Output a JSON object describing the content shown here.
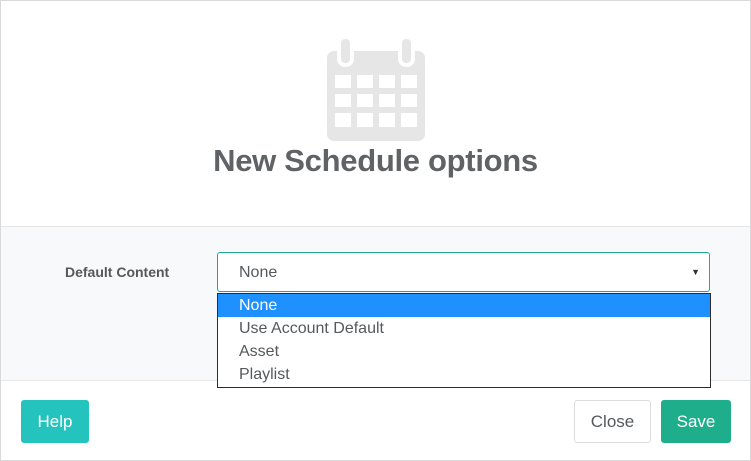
{
  "icons": {
    "header_icon": "calendar-icon",
    "dropdown_caret": "caret-down-icon",
    "icon_color": "#e6e6e6"
  },
  "modal": {
    "title": "New Schedule options"
  },
  "form": {
    "default_content": {
      "label": "Default Content",
      "value": "None",
      "caret": "▼",
      "options": [
        "None",
        "Use Account Default",
        "Asset",
        "Playlist"
      ],
      "selected_option": "None"
    }
  },
  "footer": {
    "help_label": "Help",
    "close_label": "Close",
    "save_label": "Save"
  },
  "colors": {
    "help": "#25c3bd",
    "save": "#1fae8b",
    "select_border": "#20a98f",
    "option_highlight": "#1e90ff"
  }
}
